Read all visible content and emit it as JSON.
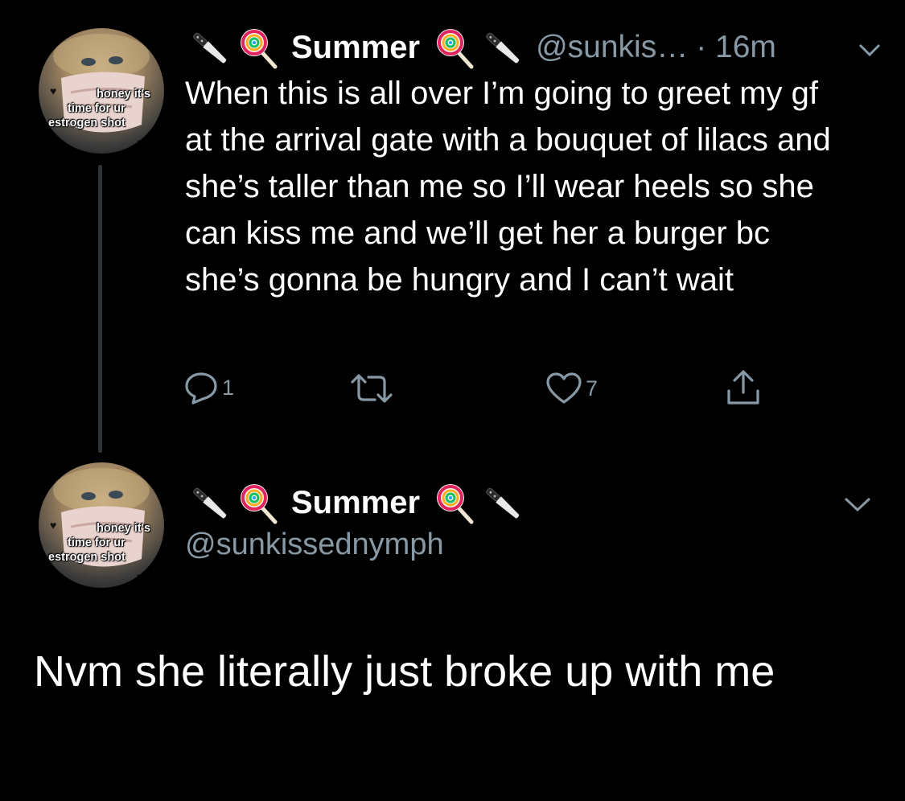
{
  "tweet1": {
    "display_name": "Summer",
    "handle_truncated": "@sunkis…",
    "timestamp": "· 16m",
    "avatar_caption": [
      "honey it's",
      "time for ur",
      "estrogen shot"
    ],
    "text": "When this is all over I’m going to greet my gf at the arrival gate with a bouquet of lilacs and she’s taller than me so I’ll wear heels so she can kiss me and we’ll get her a burger bc she’s gonna be hungry and I can’t wait",
    "reply_count": "1",
    "like_count": "7"
  },
  "tweet2": {
    "display_name": "Summer",
    "handle": "@sunkissednymph",
    "avatar_caption": [
      "honey it's",
      "time for ur",
      "estrogen shot"
    ],
    "text": "Nvm she literally just broke up with me"
  },
  "icons": {
    "name_decor": [
      "knife-icon",
      "lollipop-icon"
    ],
    "actions": [
      "reply-icon",
      "retweet-icon",
      "like-icon",
      "share-icon"
    ],
    "more": "chevron-down-icon"
  },
  "colors": {
    "background": "#000000",
    "text": "#ffffff",
    "secondary": "#8899a6",
    "thread_line": "#2f3336"
  }
}
